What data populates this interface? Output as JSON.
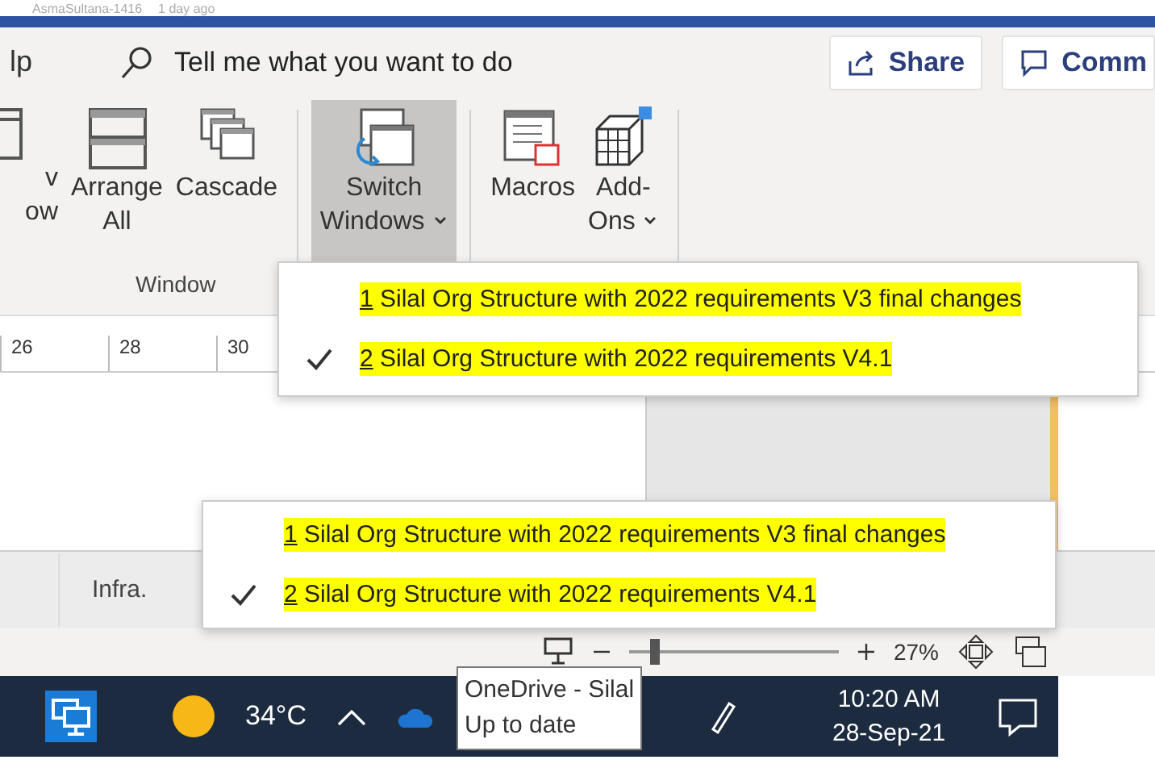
{
  "post": {
    "author": "AsmaSultana-1416",
    "time": "1 day ago"
  },
  "tell_me": {
    "menu_fragment": "lp",
    "placeholder": "Tell me what you want to do"
  },
  "share_button": "Share",
  "comments_button": "Comm",
  "ribbon": {
    "buttons": [
      {
        "kind": "new-window",
        "lines": [
          "v",
          "ow"
        ],
        "selected": false,
        "dropdown": false
      },
      {
        "kind": "arrange",
        "lines": [
          "Arrange",
          "All"
        ],
        "selected": false,
        "dropdown": false
      },
      {
        "kind": "cascade",
        "lines": [
          "Cascade"
        ],
        "selected": false,
        "dropdown": false
      },
      {
        "kind": "switch",
        "lines": [
          "Switch",
          "Windows"
        ],
        "selected": true,
        "dropdown": true
      },
      {
        "kind": "macros",
        "lines": [
          "Macros"
        ],
        "selected": false,
        "dropdown": false
      },
      {
        "kind": "addons",
        "lines": [
          "Add-",
          "Ons"
        ],
        "selected": false,
        "dropdown": true
      }
    ],
    "group_label": "Window"
  },
  "ruler": [
    "26",
    "28",
    "30"
  ],
  "menus": [
    {
      "items": [
        {
          "number": "1",
          "text": " Silal Org Structure with 2022 requirements V3 final changes",
          "checked": false,
          "highlighted": true
        },
        {
          "number": "2",
          "text": " Silal Org Structure with 2022 requirements V4.1",
          "checked": true,
          "highlighted": true
        }
      ]
    },
    {
      "items": [
        {
          "number": "1",
          "text": " Silal Org Structure with 2022 requirements V3 final changes",
          "checked": false,
          "highlighted": true
        },
        {
          "number": "2",
          "text": " Silal Org Structure with 2022 requirements V4.1",
          "checked": true,
          "highlighted": true
        }
      ]
    }
  ],
  "sheet_tabs": [
    "Infra."
  ],
  "status_bar": {
    "zoom": {
      "level": 0.12
    },
    "zoom_reading": "27%"
  },
  "taskbar": {
    "temperature": "34°C",
    "time": "10:20 AM",
    "date": "28-Sep-21"
  },
  "tooltip": {
    "lines": [
      "OneDrive - Silal",
      "Up to date"
    ]
  }
}
